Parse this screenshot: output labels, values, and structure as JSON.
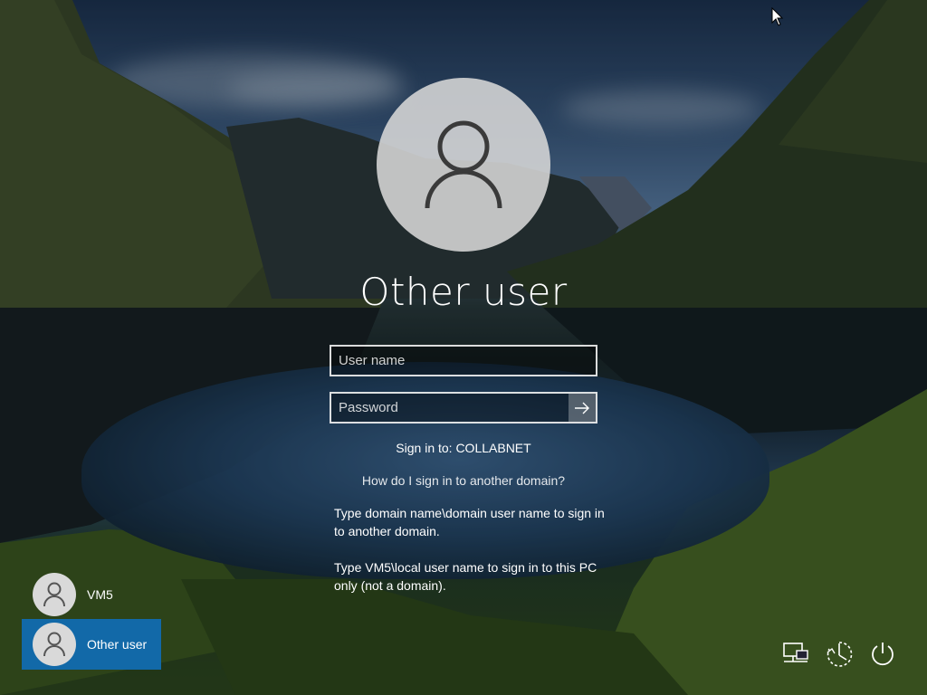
{
  "login": {
    "title": "Other user",
    "username_placeholder": "User name",
    "password_placeholder": "Password",
    "signin_to": "Sign in to: COLLABNET",
    "help_link": "How do I sign in to another domain?",
    "help_text_1": "Type domain name\\domain user name to sign in to another domain.",
    "help_text_2": "Type VM5\\local user name to sign in to this PC only (not a domain)."
  },
  "users": [
    {
      "name": "VM5",
      "selected": false
    },
    {
      "name": "Other user",
      "selected": true
    }
  ],
  "system_icons": [
    "network-icon",
    "ease-of-access-icon",
    "power-icon"
  ],
  "colors": {
    "accent": "#1269a8"
  }
}
